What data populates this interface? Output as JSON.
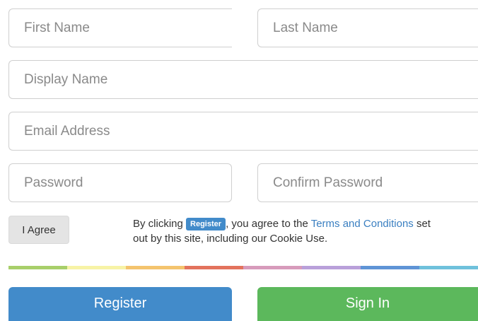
{
  "form": {
    "first_name": {
      "placeholder": "First Name",
      "value": ""
    },
    "last_name": {
      "placeholder": "Last Name",
      "value": ""
    },
    "display_name": {
      "placeholder": "Display Name",
      "value": ""
    },
    "email": {
      "placeholder": "Email Address",
      "value": ""
    },
    "password": {
      "placeholder": "Password",
      "value": ""
    },
    "confirm_password": {
      "placeholder": "Confirm Password",
      "value": ""
    }
  },
  "agree": {
    "button_label": "I Agree",
    "text_before": "By clicking ",
    "badge_label": "Register",
    "text_middle": ", you agree to the ",
    "link_label": "Terms and Conditions",
    "text_after": " set",
    "line2": "out by this site, including our Cookie Use."
  },
  "divider_colors": [
    "#a8cf6a",
    "#f7f3a6",
    "#f4c46e",
    "#e3735d",
    "#d79bbb",
    "#b9a0da",
    "#5f94d6",
    "#6fc1dc"
  ],
  "actions": {
    "register_label": "Register",
    "signin_label": "Sign In"
  },
  "colors": {
    "primary": "#428bca",
    "success": "#5cb85c",
    "link": "#3a7fc1"
  }
}
